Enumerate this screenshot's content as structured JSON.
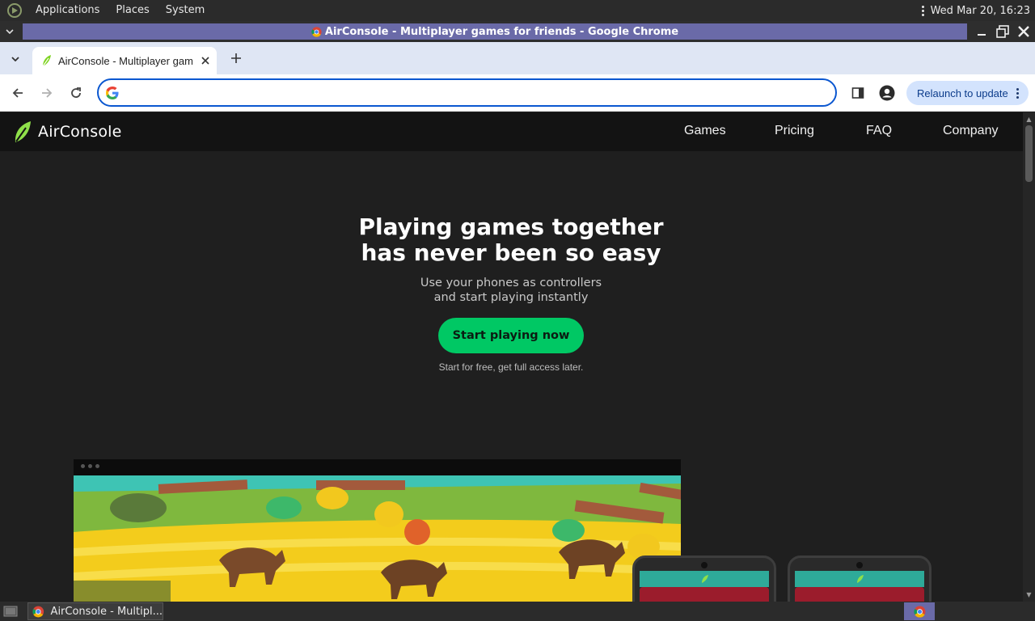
{
  "top_panel": {
    "menus": [
      "Applications",
      "Places",
      "System"
    ],
    "clock": "Wed Mar 20, 16:23"
  },
  "window": {
    "title": "AirConsole - Multiplayer games for friends - Google Chrome"
  },
  "browser": {
    "tab": {
      "title": "AirConsole - Multiplayer games for friends"
    },
    "omnibox": {
      "value": "",
      "placeholder": ""
    },
    "relaunch_label": "Relaunch to update"
  },
  "site": {
    "brand": "AirConsole",
    "nav": [
      "Games",
      "Pricing",
      "FAQ",
      "Company"
    ],
    "hero": {
      "heading_line1": "Playing games together",
      "heading_line2": "has never been so easy",
      "sub_line1": "Use your phones as controllers",
      "sub_line2": "and start playing instantly",
      "cta_label": "Start playing now",
      "cta_note": "Start for free, get full access later."
    },
    "accent_color": "#00c864"
  },
  "taskbar": {
    "task_label": "AirConsole - Multipl..."
  },
  "icons": {
    "distro": "distro-logo-icon",
    "chrome": "chrome-icon",
    "google": "google-g-icon",
    "leaf": "airconsole-leaf-icon"
  }
}
